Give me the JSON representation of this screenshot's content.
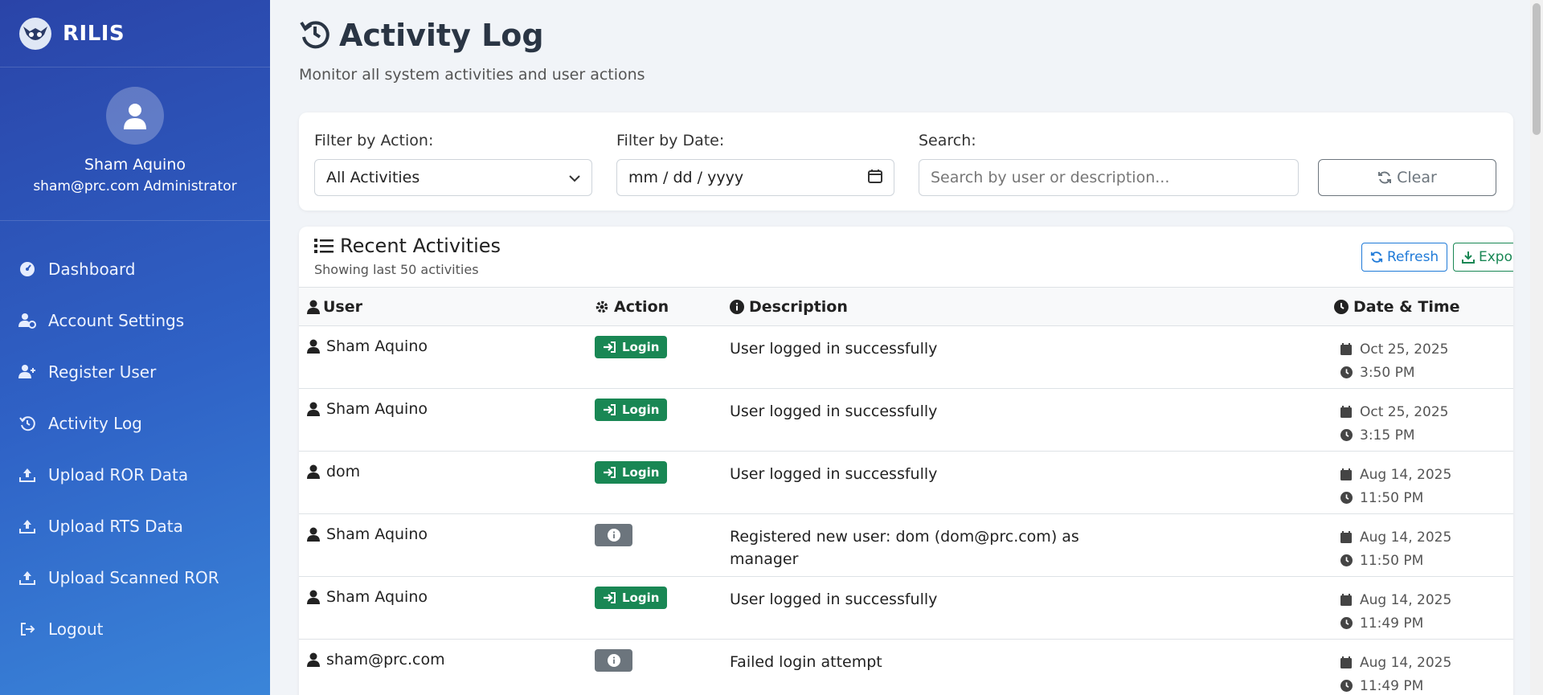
{
  "brand": {
    "name": "RILIS"
  },
  "profile": {
    "name": "Sham Aquino",
    "email_role": "sham@prc.com Administrator"
  },
  "nav": [
    {
      "label": "Dashboard",
      "icon": "gauge-icon"
    },
    {
      "label": "Account Settings",
      "icon": "user-gear-icon"
    },
    {
      "label": "Register User",
      "icon": "user-plus-icon"
    },
    {
      "label": "Activity Log",
      "icon": "history-icon"
    },
    {
      "label": "Upload ROR Data",
      "icon": "upload-icon"
    },
    {
      "label": "Upload RTS Data",
      "icon": "upload-icon"
    },
    {
      "label": "Upload Scanned ROR",
      "icon": "upload-icon"
    },
    {
      "label": "Logout",
      "icon": "logout-icon"
    }
  ],
  "page": {
    "title": "Activity Log",
    "subtitle": "Monitor all system activities and user actions"
  },
  "filters": {
    "action_label": "Filter by Action:",
    "action_value": "All Activities",
    "date_label": "Filter by Date:",
    "date_placeholder": "mm / dd / yyyy",
    "search_label": "Search:",
    "search_placeholder": "Search by user or description...",
    "clear_label": "Clear"
  },
  "card": {
    "title": "Recent Activities",
    "subtitle": "Showing last 50 activities",
    "refresh_label": "Refresh",
    "export_label": "Export"
  },
  "columns": {
    "user": "User",
    "action": "Action",
    "description": "Description",
    "datetime": "Date & Time"
  },
  "rows": [
    {
      "user": "Sham Aquino",
      "action": "Login",
      "action_type": "login",
      "description": "User logged in successfully",
      "date": "Oct 25, 2025",
      "time": "3:50 PM"
    },
    {
      "user": "Sham Aquino",
      "action": "Login",
      "action_type": "login",
      "description": "User logged in successfully",
      "date": "Oct 25, 2025",
      "time": "3:15 PM"
    },
    {
      "user": "dom",
      "action": "Login",
      "action_type": "login",
      "description": "User logged in successfully",
      "date": "Aug 14, 2025",
      "time": "11:50 PM"
    },
    {
      "user": "Sham Aquino",
      "action": "",
      "action_type": "info",
      "description": "Registered new user: dom (dom@prc.com) as manager",
      "date": "Aug 14, 2025",
      "time": "11:50 PM"
    },
    {
      "user": "Sham Aquino",
      "action": "Login",
      "action_type": "login",
      "description": "User logged in successfully",
      "date": "Aug 14, 2025",
      "time": "11:49 PM"
    },
    {
      "user": "sham@prc.com",
      "action": "",
      "action_type": "info",
      "description": "Failed login attempt",
      "date": "Aug 14, 2025",
      "time": "11:49 PM"
    }
  ],
  "colors": {
    "sidebar_start": "#2a44a8",
    "sidebar_end": "#3a85d9",
    "login_badge": "#198754",
    "info_badge": "#6c757d",
    "refresh": "#1f7ad8",
    "export": "#198754"
  }
}
